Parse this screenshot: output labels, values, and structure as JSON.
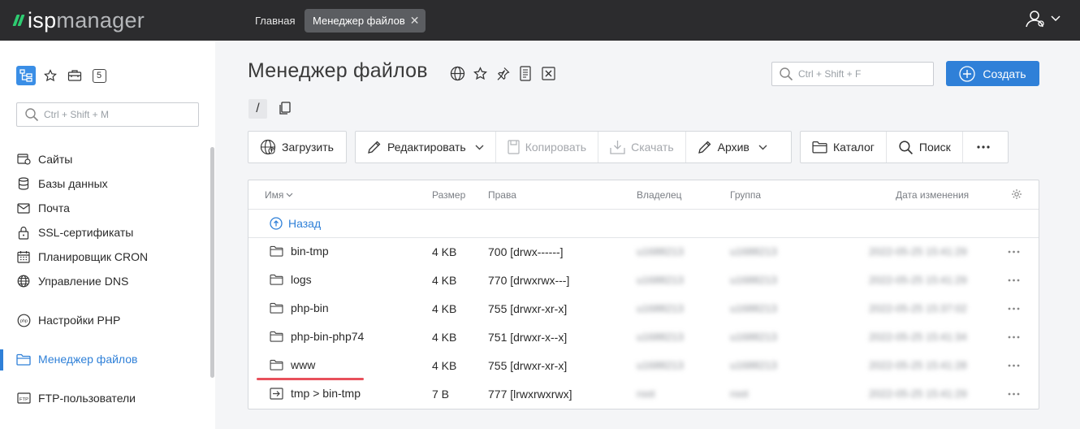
{
  "app": {
    "logo_main": "isp",
    "logo_sub": "manager"
  },
  "topbar": {
    "tabs": [
      {
        "label": "Главная"
      },
      {
        "label": "Менеджер файлов"
      }
    ]
  },
  "sidebar": {
    "search_placeholder": "Ctrl + Shift + M",
    "badge": "5",
    "items": [
      {
        "label": "Сайты",
        "icon": "sites-icon"
      },
      {
        "label": "Базы данных",
        "icon": "database-icon"
      },
      {
        "label": "Почта",
        "icon": "mail-icon"
      },
      {
        "label": "SSL-сертификаты",
        "icon": "lock-icon"
      },
      {
        "label": "Планировщик CRON",
        "icon": "calendar-icon"
      },
      {
        "label": "Управление DNS",
        "icon": "globe-icon"
      },
      {
        "label": "Настройки PHP",
        "icon": "php-icon"
      },
      {
        "label": "Менеджер файлов",
        "icon": "folder-icon",
        "active": true
      },
      {
        "label": "FTP-пользователи",
        "icon": "ftp-icon"
      }
    ]
  },
  "main": {
    "title": "Менеджер файлов",
    "search_placeholder": "Ctrl + Shift + F",
    "create_label": "Создать",
    "path": "/",
    "toolbar": {
      "upload": "Загрузить",
      "edit": "Редактировать",
      "copy": "Копировать",
      "download": "Скачать",
      "archive": "Архив",
      "directory": "Каталог",
      "search": "Поиск"
    },
    "table": {
      "columns": {
        "name": "Имя",
        "size": "Размер",
        "perms": "Права",
        "owner": "Владелец",
        "group": "Группа",
        "modified": "Дата изменения"
      },
      "back_label": "Назад",
      "rows": [
        {
          "name": "bin-tmp",
          "type": "folder",
          "size": "4 KB",
          "perms": "700 [drwx------]",
          "owner": "u1688213",
          "group": "u1688213",
          "modified": "2022-05-25 15:41:29"
        },
        {
          "name": "logs",
          "type": "folder",
          "size": "4 KB",
          "perms": "770 [drwxrwx---]",
          "owner": "u1688213",
          "group": "u1688213",
          "modified": "2022-05-25 15:41:29"
        },
        {
          "name": "php-bin",
          "type": "folder",
          "size": "4 KB",
          "perms": "755 [drwxr-xr-x]",
          "owner": "u1688213",
          "group": "u1688213",
          "modified": "2022-05-25 15:37:02"
        },
        {
          "name": "php-bin-php74",
          "type": "folder",
          "size": "4 KB",
          "perms": "751 [drwxr-x--x]",
          "owner": "u1688213",
          "group": "u1688213",
          "modified": "2022-05-25 15:41:34"
        },
        {
          "name": "www",
          "type": "folder",
          "size": "4 KB",
          "perms": "755 [drwxr-xr-x]",
          "owner": "u1688213",
          "group": "u1688213",
          "modified": "2022-05-25 15:41:28"
        },
        {
          "name": "tmp > bin-tmp",
          "type": "link",
          "size": "7 B",
          "perms": "777 [lrwxrwxrwx]",
          "owner": "root",
          "group": "root",
          "modified": "2022-05-25 15:41:29"
        }
      ]
    }
  },
  "colors": {
    "accent": "#2f80d8",
    "topbar": "#2c2c2e",
    "logo_green": "#2ecc71",
    "highlight": "#e8505b"
  }
}
